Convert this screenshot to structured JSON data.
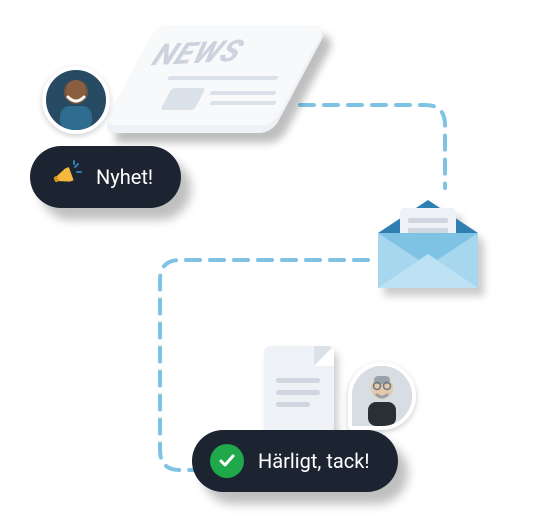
{
  "diagram": {
    "newspaper_masthead": "NEWS",
    "bubble_news": {
      "icon": "megaphone-icon",
      "label": "Nyhet!"
    },
    "bubble_reply": {
      "icon": "checkmark-icon",
      "label": "Härligt, tack!"
    }
  }
}
